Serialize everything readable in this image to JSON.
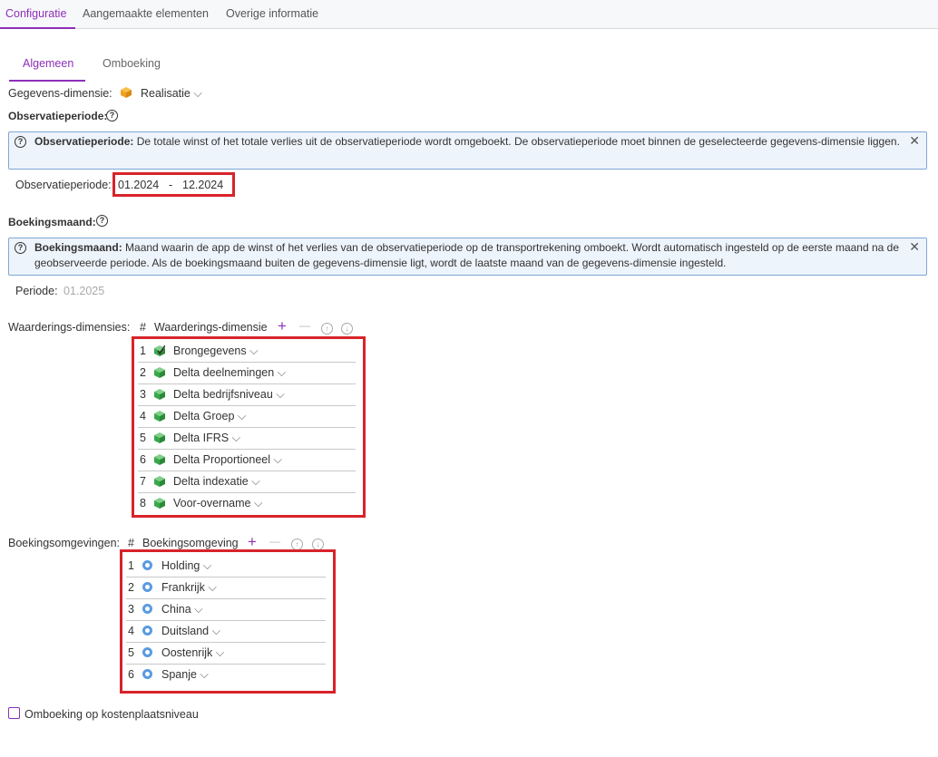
{
  "top_tabs": [
    "Configuratie",
    "Aangemaakte elementen",
    "Overige informatie"
  ],
  "sub_tabs": [
    "Algemeen",
    "Omboeking"
  ],
  "gegevens": {
    "label": "Gegevens-dimensie:",
    "value": "Realisatie",
    "chevron": "⌵"
  },
  "observatie": {
    "heading": "Observatieperiode:",
    "info_bold": "Observatieperiode:",
    "info_text": "De totale winst of het totale verlies uit de observatieperiode wordt omgeboekt. De observatieperiode moet binnen de geselecteerde gegevens-dimensie liggen.",
    "field_label": "Observatieperiode:",
    "from": "01.2024",
    "separator": "-",
    "to": "12.2024"
  },
  "boekingsmaand": {
    "heading": "Boekingsmaand:",
    "info_bold": "Boekingsmaand:",
    "info_text": "Maand waarin de app de winst of het verlies van de observatieperiode op de transportrekening omboekt. Wordt automatisch ingesteld op de eerste maand na de geobserveerde periode. Als de boekingsmaand buiten de gegevens-dimensie ligt, wordt de laatste maand van de gegevens-dimensie ingesteld.",
    "periode_label": "Periode:",
    "periode_value": "01.2025"
  },
  "waarderings": {
    "label": "Waarderings-dimensies:",
    "hash": "#",
    "column": "Waarderings-dimensie",
    "items": [
      {
        "num": "1",
        "label": "Brongegevens"
      },
      {
        "num": "2",
        "label": "Delta deelnemingen"
      },
      {
        "num": "3",
        "label": "Delta bedrijfsniveau"
      },
      {
        "num": "4",
        "label": "Delta Groep"
      },
      {
        "num": "5",
        "label": "Delta IFRS"
      },
      {
        "num": "6",
        "label": "Delta Proportioneel"
      },
      {
        "num": "7",
        "label": "Delta indexatie"
      },
      {
        "num": "8",
        "label": "Voor-overname"
      }
    ]
  },
  "boekingsomgevingen": {
    "label": "Boekingsomgevingen:",
    "hash": "#",
    "column": "Boekingsomgeving",
    "items": [
      {
        "num": "1",
        "label": "Holding"
      },
      {
        "num": "2",
        "label": "Frankrijk"
      },
      {
        "num": "3",
        "label": "China"
      },
      {
        "num": "4",
        "label": "Duitsland"
      },
      {
        "num": "5",
        "label": "Oostenrijk"
      },
      {
        "num": "6",
        "label": "Spanje"
      }
    ]
  },
  "checkbox_label": "Omboeking op kostenplaatsniveau",
  "icons": {
    "add": "+",
    "remove": "—",
    "up": "↑",
    "down": "↓",
    "close": "✕",
    "help": "?"
  },
  "colors": {
    "accent": "#8e2fb8",
    "info_bg": "#eef4fb",
    "info_border": "#7fa6d6",
    "highlight": "#d8232a",
    "cube_green": "#3aa84a",
    "cube_orange": "#f0a020",
    "ring_blue": "#5a9be0"
  }
}
